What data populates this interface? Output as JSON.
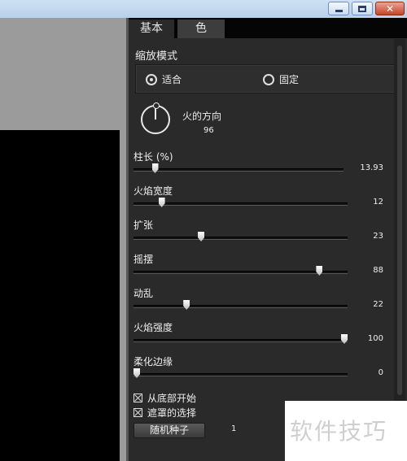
{
  "window": {
    "buttons": [
      "minimize",
      "maximize",
      "close"
    ]
  },
  "tabs": [
    {
      "label": "基本",
      "active": true
    },
    {
      "label": "色",
      "active": false
    }
  ],
  "zoom_mode": {
    "label": "缩放模式",
    "options": [
      {
        "label": "适合",
        "selected": true
      },
      {
        "label": "固定",
        "selected": false
      }
    ]
  },
  "direction": {
    "label": "火的方向",
    "value": "96"
  },
  "sliders": [
    {
      "label": "柱长 (%)",
      "value": "13.93",
      "fraction": 0.09
    },
    {
      "label": "火焰宽度",
      "value": "12",
      "fraction": 0.12
    },
    {
      "label": "扩张",
      "value": "23",
      "fraction": 0.31
    },
    {
      "label": "摇摆",
      "value": "88",
      "fraction": 0.88
    },
    {
      "label": "动乱",
      "value": "22",
      "fraction": 0.24
    },
    {
      "label": "火焰强度",
      "value": "100",
      "fraction": 1.0
    },
    {
      "label": "柔化边缘",
      "value": "0",
      "fraction": 0.0
    }
  ],
  "checkboxes": [
    {
      "label": "从底部开始",
      "checked": true
    },
    {
      "label": "遮罩的选择",
      "checked": true
    }
  ],
  "seed": {
    "button_label": "随机种子",
    "value": "1"
  },
  "watermark": {
    "text": "软件技巧"
  },
  "colors": {
    "panel": "#2a2a2a",
    "tabbar": "#050505",
    "canvas": "#9b9b9b"
  }
}
